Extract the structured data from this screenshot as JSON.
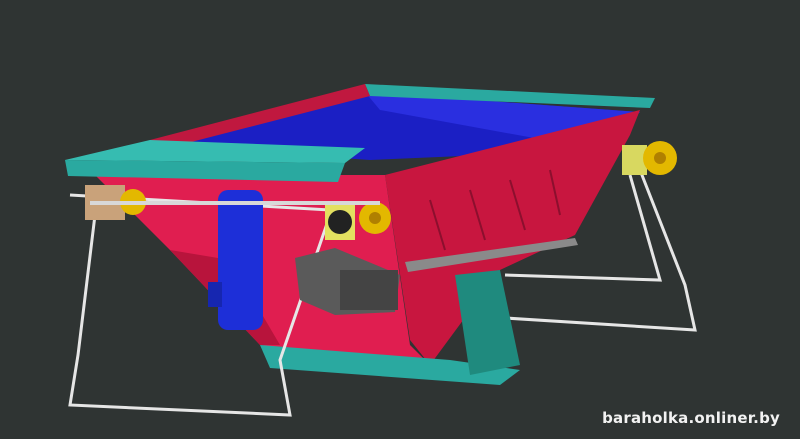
{
  "watermark": "baraholka.onliner.by",
  "colors": {
    "background": "#2f3433",
    "hopper_body": "#d81a4a",
    "interior": "#1b1fc4",
    "rim": "#2aa9a0",
    "motor": "#1d2fd8",
    "gearbox": "#5a5a5a",
    "pulley": "#e3b800",
    "frame_rod": "#e8e8e8"
  }
}
